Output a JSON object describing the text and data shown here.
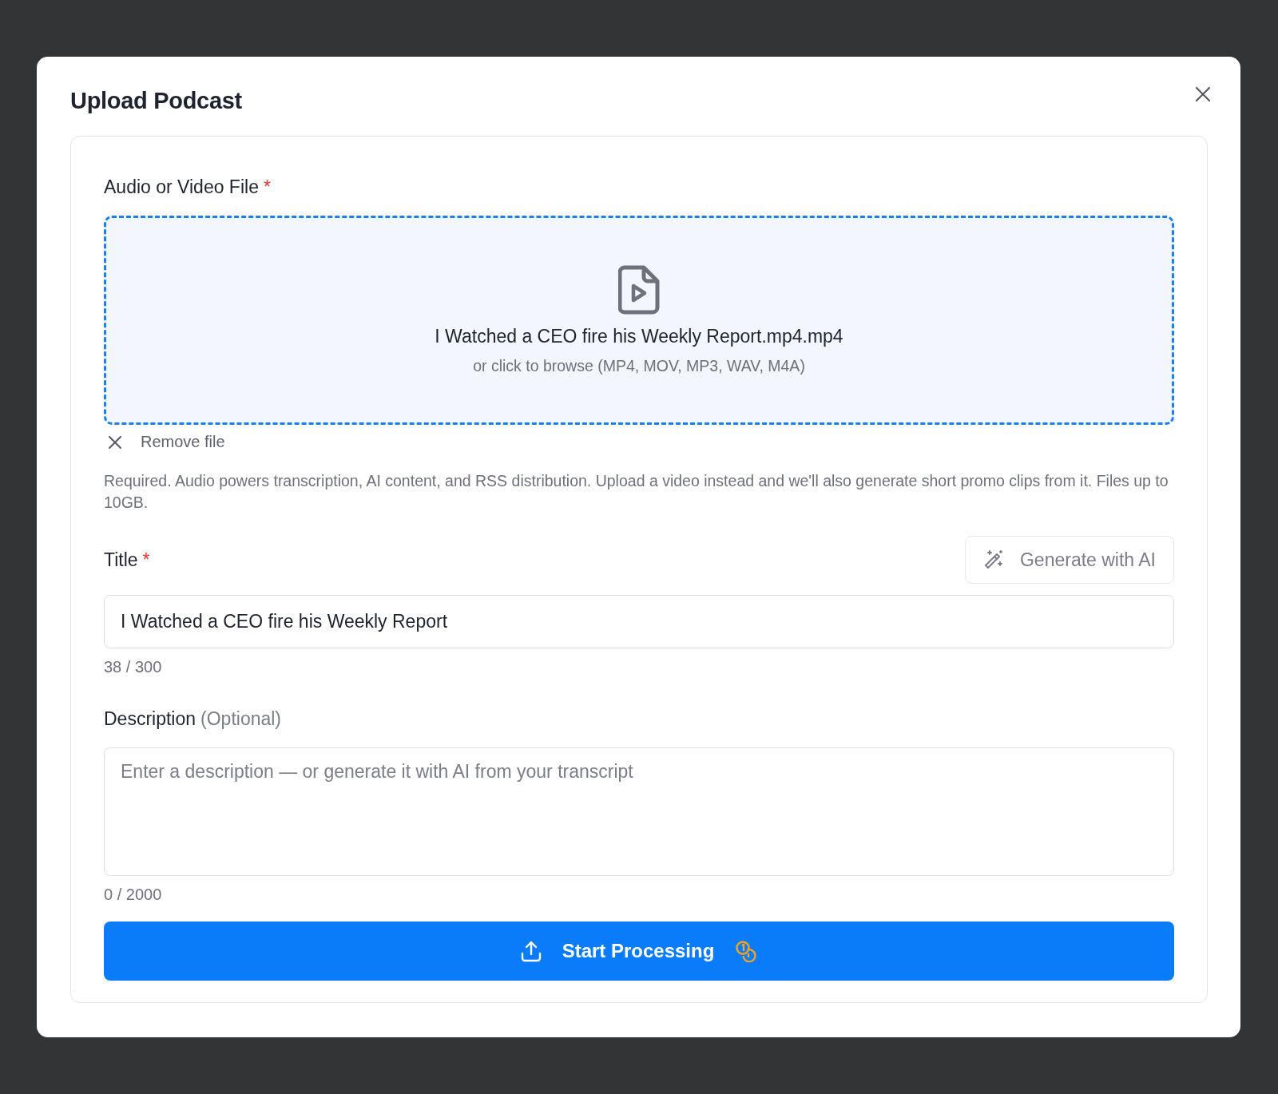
{
  "dialog": {
    "title": "Upload Podcast"
  },
  "file_field": {
    "label": "Audio or Video File",
    "required_mark": "*",
    "file_name": "I Watched a CEO fire his Weekly Report.mp4.mp4",
    "browse_hint": "or click to browse (MP4, MOV, MP3, WAV, M4A)",
    "remove_label": "Remove file",
    "help_text": "Required. Audio powers transcription, AI content, and RSS distribution. Upload a video instead and we'll also generate short promo clips from it. Files up to 10GB."
  },
  "title_field": {
    "label": "Title",
    "required_mark": "*",
    "generate_button": {
      "label": "Generate with AI",
      "disabled": true
    },
    "value": "I Watched a CEO fire his Weekly Report",
    "counter": "38 / 300"
  },
  "description_field": {
    "label": "Description",
    "optional_note": "(Optional)",
    "placeholder": "Enter a description — or generate it with AI from your transcript",
    "counter": "0 / 2000"
  },
  "submit_button": {
    "label": "Start Processing"
  }
}
